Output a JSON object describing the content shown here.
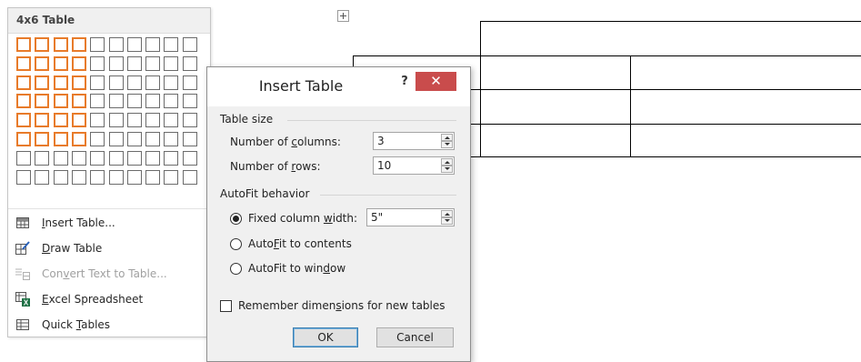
{
  "dropdown": {
    "header": "4x6 Table",
    "selection": {
      "cols": 4,
      "rows": 6
    },
    "grid": {
      "cols": 10,
      "rows": 8
    },
    "accent_color": "#e87b2a",
    "items": [
      {
        "pre": "",
        "key": "I",
        "post": "nsert Table...",
        "icon": "insert-table-icon",
        "disabled": false
      },
      {
        "pre": "",
        "key": "D",
        "post": "raw Table",
        "icon": "draw-table-icon",
        "disabled": false
      },
      {
        "pre": "Con",
        "key": "v",
        "post": "ert Text to Table...",
        "icon": "convert-text-icon",
        "disabled": true
      },
      {
        "pre": "",
        "key": "E",
        "post": "xcel Spreadsheet",
        "icon": "excel-icon",
        "disabled": false
      },
      {
        "pre": "Quick ",
        "key": "T",
        "post": "ables",
        "icon": "quick-tables-icon",
        "disabled": false
      }
    ]
  },
  "dialog": {
    "title": "Insert Table",
    "help": "?",
    "close": "✕",
    "close_color": "#c94c4c",
    "table_size": {
      "label": "Table size",
      "columns": {
        "pre": "Number of ",
        "key": "c",
        "post": "olumns:",
        "value": "3"
      },
      "rows": {
        "pre": "Number of ",
        "key": "r",
        "post": "ows:",
        "value": "10"
      }
    },
    "autofit": {
      "label": "AutoFit behavior",
      "fixed": {
        "pre": "Fixed column ",
        "key": "w",
        "post": "idth:",
        "value": "5\"",
        "selected": true
      },
      "contents": {
        "pre": "Auto",
        "key": "F",
        "post": "it to contents",
        "selected": false
      },
      "window": {
        "pre": "AutoFit to win",
        "key": "d",
        "post": "ow",
        "selected": false
      }
    },
    "remember": {
      "pre": "Remember dimen",
      "key": "s",
      "post": "ions for new tables",
      "checked": false
    },
    "ok": "OK",
    "cancel": "Cancel"
  }
}
